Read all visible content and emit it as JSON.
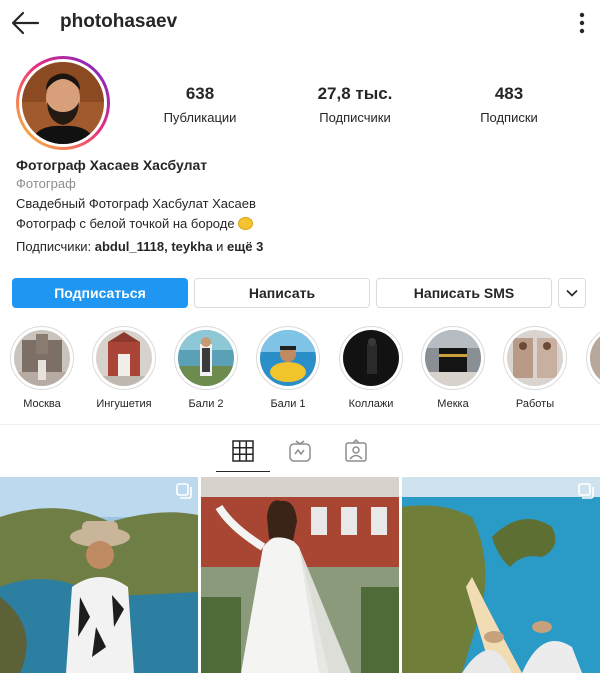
{
  "header": {
    "username": "photohasaev",
    "back_icon": "arrow-left-icon",
    "more_icon": "more-vertical-icon"
  },
  "stats": [
    {
      "value": "638",
      "label": "Публикации"
    },
    {
      "value": "27,8 тыс.",
      "label": "Подписчики"
    },
    {
      "value": "483",
      "label": "Подписки"
    }
  ],
  "bio": {
    "name": "Фотограф Хасаев Хасбулат",
    "category": "Фотограф",
    "line1": "Свадебный Фотограф Хасбулат Хасаев",
    "line2": "Фотограф с белой точкой на бороде",
    "followers_prefix": "Подписчики: ",
    "followers_names": "abdul_1118, teykha",
    "followers_and": " и ",
    "followers_more": "ещё 3"
  },
  "actions": {
    "subscribe": "Подписаться",
    "write": "Написать",
    "sms": "Написать SMS",
    "dropdown_icon": "chevron-down-icon"
  },
  "highlights": [
    {
      "label": "Москва"
    },
    {
      "label": "Ингушетия"
    },
    {
      "label": "Бали 2"
    },
    {
      "label": "Бали 1"
    },
    {
      "label": "Коллажи"
    },
    {
      "label": "Мекка"
    },
    {
      "label": "Работы"
    }
  ],
  "tabs": [
    {
      "name": "grid-icon",
      "active": true
    },
    {
      "name": "igtv-icon",
      "active": false
    },
    {
      "name": "tagged-icon",
      "active": false
    }
  ],
  "colors": {
    "accent": "#1f96f2",
    "text": "#262626",
    "muted": "#8e8e8e",
    "border": "#dbdbdb"
  }
}
